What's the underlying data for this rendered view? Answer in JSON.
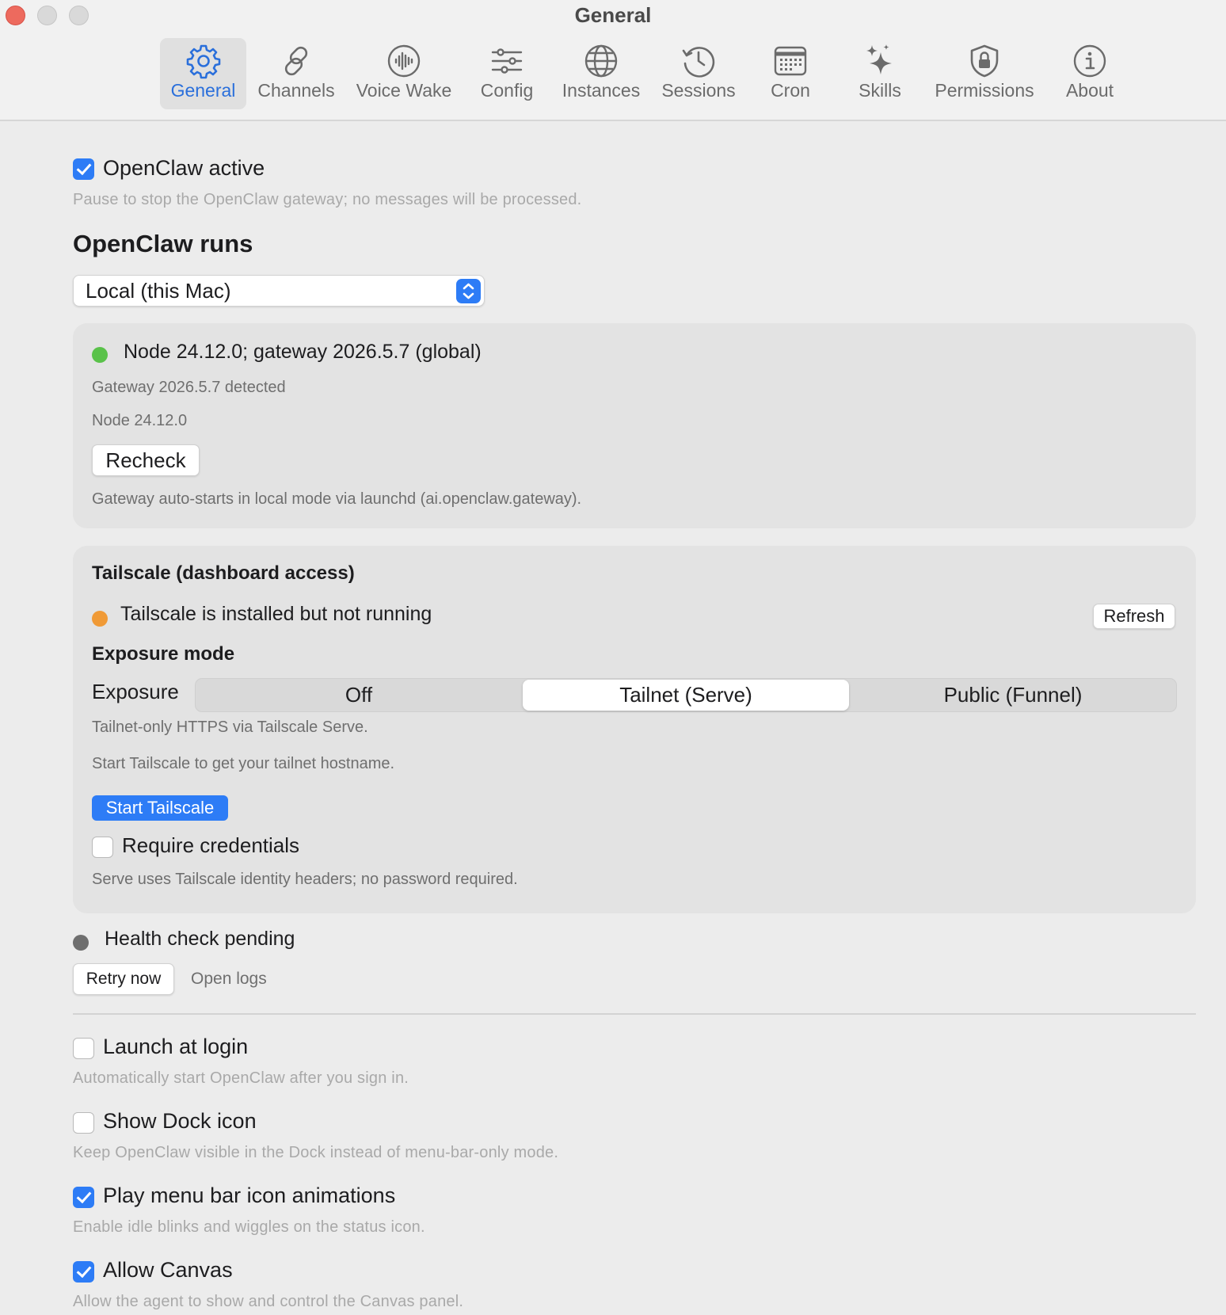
{
  "window": {
    "title": "General"
  },
  "toolbar": {
    "tabs": [
      {
        "label": "General",
        "icon": "gear-icon",
        "active": true
      },
      {
        "label": "Channels",
        "icon": "link-icon",
        "active": false
      },
      {
        "label": "Voice Wake",
        "icon": "waveform-icon",
        "active": false
      },
      {
        "label": "Config",
        "icon": "sliders-icon",
        "active": false
      },
      {
        "label": "Instances",
        "icon": "globe-icon",
        "active": false
      },
      {
        "label": "Sessions",
        "icon": "history-clock-icon",
        "active": false
      },
      {
        "label": "Cron",
        "icon": "calendar-icon",
        "active": false
      },
      {
        "label": "Skills",
        "icon": "sparkles-icon",
        "active": false
      },
      {
        "label": "Permissions",
        "icon": "lock-shield-icon",
        "active": false
      },
      {
        "label": "About",
        "icon": "info-icon",
        "active": false
      }
    ]
  },
  "general": {
    "active": {
      "label": "OpenClaw active",
      "checked": true,
      "hint": "Pause to stop the OpenClaw gateway; no messages will be processed."
    },
    "runs_heading": "OpenClaw runs",
    "runs_select": {
      "value": "Local (this Mac)"
    },
    "status_panel": {
      "status_text": "Node 24.12.0; gateway 2026.5.7 (global)",
      "status_color": "#5ac24a",
      "gateway_detected": "Gateway 2026.5.7 detected",
      "node_version": "Node 24.12.0",
      "recheck_label": "Recheck",
      "autostart_note": "Gateway auto-starts in local mode via launchd (ai.openclaw.gateway)."
    },
    "tailscale": {
      "heading": "Tailscale (dashboard access)",
      "status_text": "Tailscale is installed but not running",
      "status_color": "#f09a36",
      "refresh_label": "Refresh",
      "exposure_heading": "Exposure mode",
      "exposure_label": "Exposure",
      "exposure_options": [
        "Off",
        "Tailnet (Serve)",
        "Public (Funnel)"
      ],
      "exposure_selected": "Tailnet (Serve)",
      "exposure_note": "Tailnet-only HTTPS via Tailscale Serve.",
      "hostname_note": "Start Tailscale to get your tailnet hostname.",
      "start_label": "Start Tailscale",
      "require_credentials": {
        "label": "Require credentials",
        "checked": false
      },
      "credentials_note": "Serve uses Tailscale identity headers; no password required."
    },
    "health": {
      "status_text": "Health check pending",
      "status_color": "#6e6e6e",
      "retry_label": "Retry now",
      "open_logs_label": "Open logs"
    },
    "options": {
      "launch_at_login": {
        "label": "Launch at login",
        "checked": false,
        "hint": "Automatically start OpenClaw after you sign in."
      },
      "show_dock_icon": {
        "label": "Show Dock icon",
        "checked": false,
        "hint": "Keep OpenClaw visible in the Dock instead of menu-bar-only mode."
      },
      "menu_bar_animations": {
        "label": "Play menu bar icon animations",
        "checked": true,
        "hint": "Enable idle blinks and wiggles on the status icon."
      },
      "allow_canvas": {
        "label": "Allow Canvas",
        "checked": true,
        "hint": "Allow the agent to show and control the Canvas panel."
      }
    }
  },
  "colors": {
    "accent": "#2d7cf6",
    "background": "#ececec",
    "panel": "#e3e3e3"
  }
}
